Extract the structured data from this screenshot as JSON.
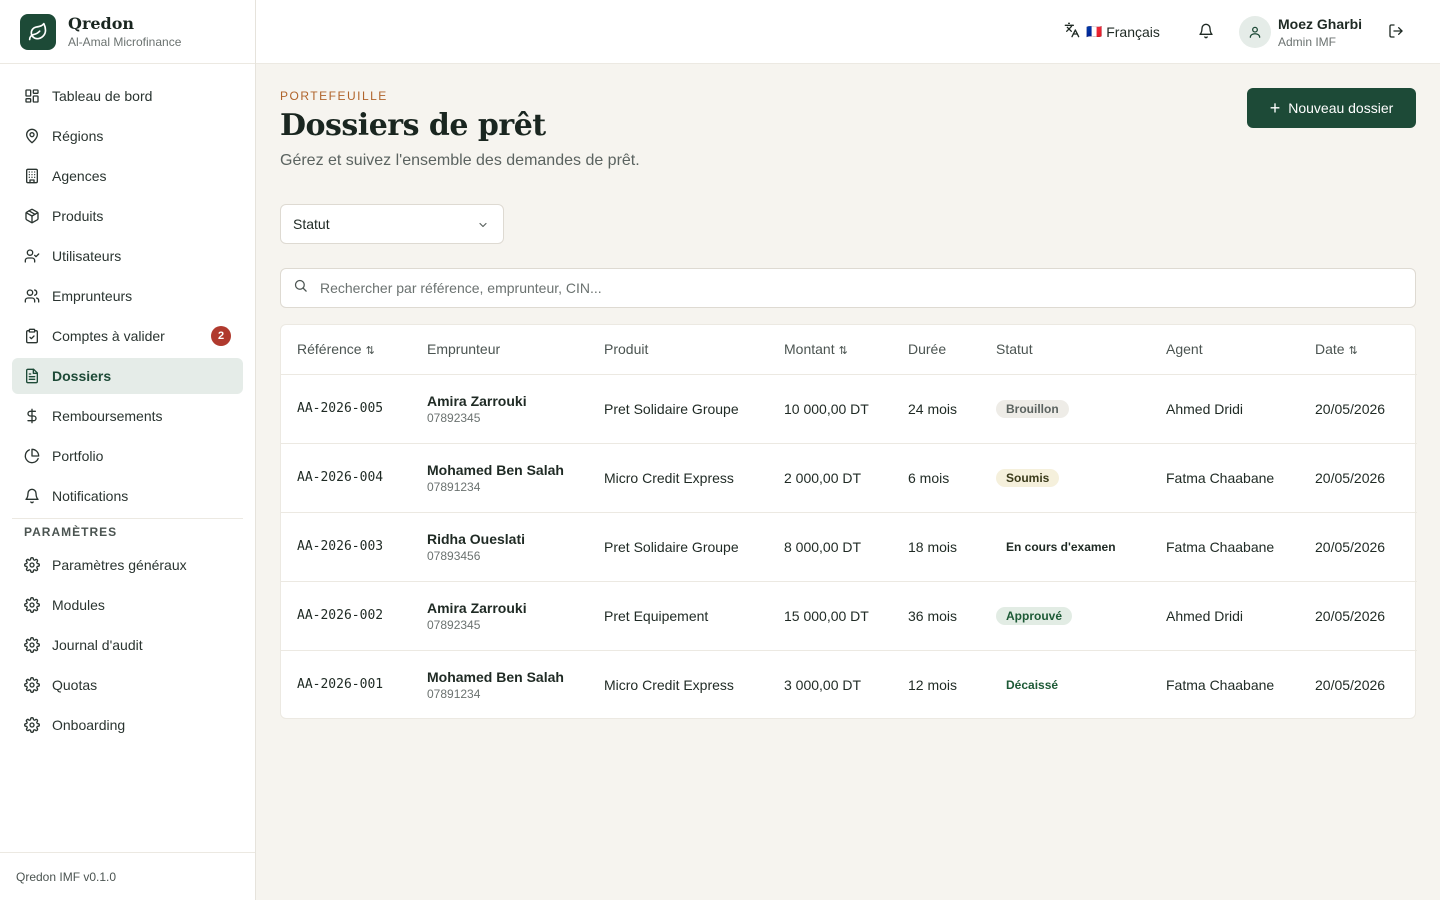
{
  "brand": {
    "name": "Qredon",
    "sub": "Al-Amal Microfinance"
  },
  "sidebar": {
    "items": [
      {
        "label": "Tableau de bord",
        "icon": "dashboard-icon"
      },
      {
        "label": "Régions",
        "icon": "map-pin-icon"
      },
      {
        "label": "Agences",
        "icon": "building-icon"
      },
      {
        "label": "Produits",
        "icon": "package-icon"
      },
      {
        "label": "Utilisateurs",
        "icon": "user-check-icon"
      },
      {
        "label": "Emprunteurs",
        "icon": "users-icon"
      },
      {
        "label": "Comptes à valider",
        "icon": "clipboard-check-icon",
        "badge": "2"
      },
      {
        "label": "Dossiers",
        "icon": "file-text-icon",
        "active": true
      },
      {
        "label": "Remboursements",
        "icon": "dollar-icon"
      },
      {
        "label": "Portfolio",
        "icon": "pie-chart-icon"
      },
      {
        "label": "Notifications",
        "icon": "bell-icon"
      }
    ],
    "section_label": "PARAMÈTRES",
    "settings": [
      {
        "label": "Paramètres généraux",
        "icon": "gear-icon"
      },
      {
        "label": "Modules",
        "icon": "gear-icon"
      },
      {
        "label": "Journal d'audit",
        "icon": "gear-icon"
      },
      {
        "label": "Quotas",
        "icon": "gear-icon"
      },
      {
        "label": "Onboarding",
        "icon": "gear-icon"
      }
    ],
    "footer": "Qredon IMF v0.1.0"
  },
  "topbar": {
    "language": "Français",
    "flag": "🇫🇷",
    "user_name": "Moez Gharbi",
    "user_role": "Admin IMF"
  },
  "page": {
    "eyebrow": "PORTEFEUILLE",
    "title": "Dossiers de prêt",
    "subtitle": "Gérez et suivez l'ensemble des demandes de prêt.",
    "new_button": "Nouveau dossier",
    "status_filter": "Statut",
    "search_placeholder": "Rechercher par référence, emprunteur, CIN..."
  },
  "table": {
    "columns": [
      "Référence",
      "Emprunteur",
      "Produit",
      "Montant",
      "Durée",
      "Statut",
      "Agent",
      "Date"
    ],
    "rows": [
      {
        "ref": "AA-2026-005",
        "name": "Amira Zarrouki",
        "cin": "07892345",
        "product": "Pret Solidaire Groupe",
        "amount": "10 000,00 DT",
        "duration": "24 mois",
        "status": "Brouillon",
        "agent": "Ahmed Dridi",
        "date": "20/05/2026"
      },
      {
        "ref": "AA-2026-004",
        "name": "Mohamed Ben Salah",
        "cin": "07891234",
        "product": "Micro Credit Express",
        "amount": "2 000,00 DT",
        "duration": "6 mois",
        "status": "Soumis",
        "agent": "Fatma Chaabane",
        "date": "20/05/2026"
      },
      {
        "ref": "AA-2026-003",
        "name": "Ridha Oueslati",
        "cin": "07893456",
        "product": "Pret Solidaire Groupe",
        "amount": "8 000,00 DT",
        "duration": "18 mois",
        "status": "En cours d'examen",
        "agent": "Fatma Chaabane",
        "date": "20/05/2026"
      },
      {
        "ref": "AA-2026-002",
        "name": "Amira Zarrouki",
        "cin": "07892345",
        "product": "Pret Equipement",
        "amount": "15 000,00 DT",
        "duration": "36 mois",
        "status": "Approuvé",
        "agent": "Ahmed Dridi",
        "date": "20/05/2026"
      },
      {
        "ref": "AA-2026-001",
        "name": "Mohamed Ben Salah",
        "cin": "07891234",
        "product": "Micro Credit Express",
        "amount": "3 000,00 DT",
        "duration": "12 mois",
        "status": "Décaissé",
        "agent": "Fatma Chaabane",
        "date": "20/05/2026"
      }
    ]
  },
  "status_colors": {
    "Brouillon": {
      "bg": "#eeece7",
      "fg": "#5b6360"
    },
    "Soumis": {
      "bg": "#f5f0dc",
      "fg": "#3a3a1a"
    },
    "En cours d'examen": {
      "bg": "#ffffff",
      "fg": "#1f2a24"
    },
    "Approuvé": {
      "bg": "#e2ece4",
      "fg": "#1d5a36"
    },
    "Décaissé": {
      "bg": "#ffffff",
      "fg": "#1d5a36"
    }
  },
  "colors": {
    "accent": "#1d4a37",
    "badge": "#b03a2e",
    "eyebrow": "#b0642b"
  }
}
